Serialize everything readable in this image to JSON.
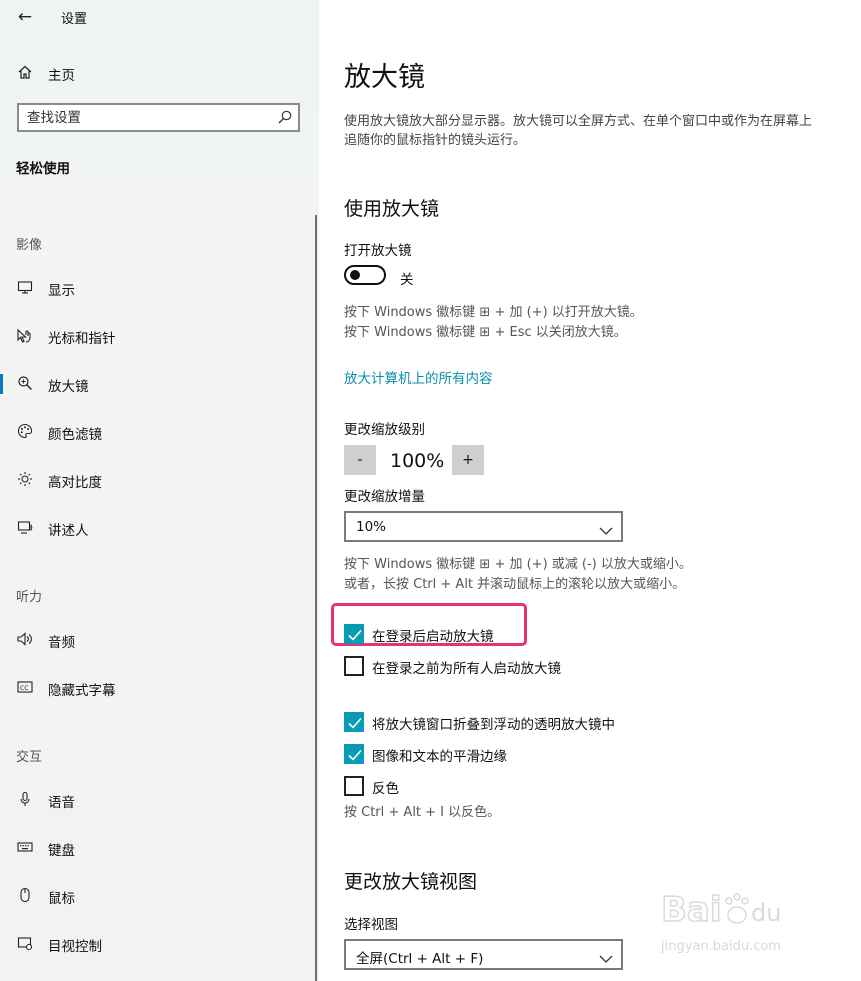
{
  "window": {
    "title": "设置",
    "back_glyph": "←"
  },
  "sidebar": {
    "home_label": "主页",
    "search_placeholder": "查找设置",
    "section_title": "轻松使用",
    "groups": [
      {
        "title": "影像",
        "items": [
          {
            "label": "显示",
            "icon": "monitor-icon"
          },
          {
            "label": "光标和指针",
            "icon": "cursor-icon"
          },
          {
            "label": "放大镜",
            "icon": "magnifier-icon",
            "active": true
          },
          {
            "label": "颜色滤镜",
            "icon": "palette-icon"
          },
          {
            "label": "高对比度",
            "icon": "brightness-icon"
          },
          {
            "label": "讲述人",
            "icon": "narrator-icon"
          }
        ]
      },
      {
        "title": "听力",
        "items": [
          {
            "label": "音频",
            "icon": "speaker-icon"
          },
          {
            "label": "隐藏式字幕",
            "icon": "captions-icon"
          }
        ]
      },
      {
        "title": "交互",
        "items": [
          {
            "label": "语音",
            "icon": "microphone-icon"
          },
          {
            "label": "键盘",
            "icon": "keyboard-icon"
          },
          {
            "label": "鼠标",
            "icon": "mouse-icon"
          },
          {
            "label": "目视控制",
            "icon": "eye-control-icon"
          }
        ]
      }
    ]
  },
  "main": {
    "title": "放大镜",
    "description": "使用放大镜放大部分显示器。放大镜可以全屏方式、在单个窗口中或作为在屏幕上追随你的鼠标指针的镜头运行。",
    "use_section": {
      "heading": "使用放大镜",
      "toggle_label": "打开放大镜",
      "toggle_state": "关",
      "toggle_on": false,
      "hint_line1": "按下 Windows 徽标键 ⊞ + 加 (+) 以打开放大镜。",
      "hint_line2": "按下 Windows 徽标键 ⊞ + Esc 以关闭放大镜。",
      "link": "放大计算机上的所有内容"
    },
    "zoom": {
      "level_label": "更改缩放级别",
      "minus": "-",
      "plus": "+",
      "value": "100%",
      "increment_label": "更改缩放增量",
      "increment_value": "10%",
      "hint_line1": "按下 Windows 徽标键 ⊞ + 加 (+) 或减 (-) 以放大或缩小。",
      "hint_line2": "或者，长按 Ctrl + Alt 并滚动鼠标上的滚轮以放大或缩小。"
    },
    "options": [
      {
        "label": "在登录后启动放大镜",
        "checked": true
      },
      {
        "label": "在登录之前为所有人启动放大镜",
        "checked": false
      },
      {
        "label": "将放大镜窗口折叠到浮动的透明放大镜中",
        "checked": true
      },
      {
        "label": "图像和文本的平滑边缘",
        "checked": true
      },
      {
        "label": "反色",
        "checked": false
      }
    ],
    "invert_hint": "按 Ctrl + Alt + I 以反色。",
    "view_section": {
      "heading": "更改放大镜视图",
      "select_label": "选择视图",
      "select_value": "全屏(Ctrl + Alt + F)"
    }
  },
  "watermark": {
    "text": "jingyan.baidu.com"
  },
  "colors": {
    "accent": "#0a9bb4",
    "link": "#0a8ea8",
    "highlight": "#e8336d"
  }
}
